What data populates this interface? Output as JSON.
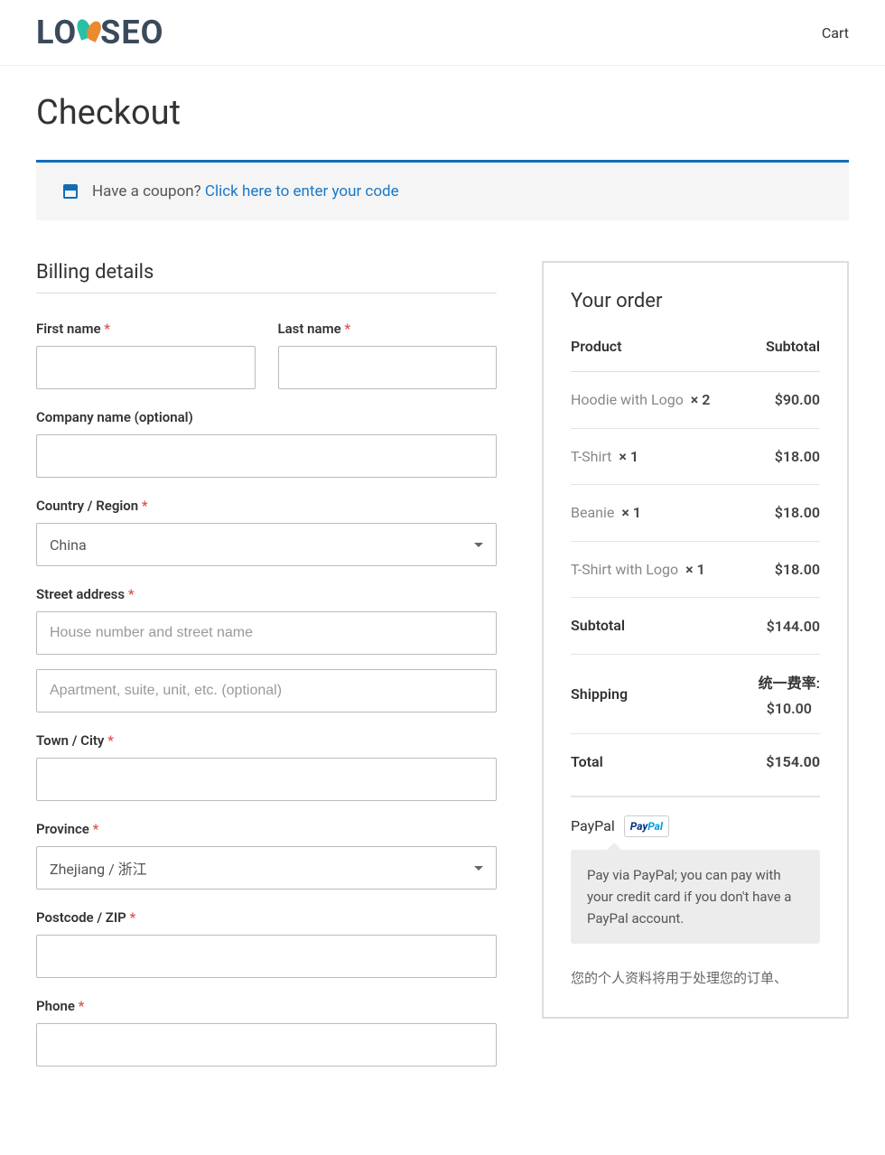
{
  "header": {
    "logo_text_left": "LO",
    "logo_text_right": "SEO",
    "cart_link": "Cart"
  },
  "page": {
    "title": "Checkout"
  },
  "coupon": {
    "prompt": "Have a coupon? ",
    "link": "Click here to enter your code"
  },
  "billing": {
    "heading": "Billing details",
    "first_name_label": "First name",
    "last_name_label": "Last name",
    "company_label": "Company name (optional)",
    "country_label": "Country / Region",
    "country_value": "China",
    "street_label": "Street address",
    "street_ph1": "House number and street name",
    "street_ph2": "Apartment, suite, unit, etc. (optional)",
    "city_label": "Town / City",
    "province_label": "Province",
    "province_value": "Zhejiang / 浙江",
    "zip_label": "Postcode / ZIP",
    "phone_label": "Phone"
  },
  "order": {
    "heading": "Your order",
    "col_product": "Product",
    "col_subtotal": "Subtotal",
    "items": [
      {
        "name": "Hoodie with Logo",
        "qty": "2",
        "subtotal": "$90.00"
      },
      {
        "name": "T-Shirt",
        "qty": "1",
        "subtotal": "$18.00"
      },
      {
        "name": "Beanie",
        "qty": "1",
        "subtotal": "$18.00"
      },
      {
        "name": "T-Shirt with Logo",
        "qty": "1",
        "subtotal": "$18.00"
      }
    ],
    "subtotal_label": "Subtotal",
    "subtotal_value": "$144.00",
    "shipping_label": "Shipping",
    "shipping_method": "统一费率:",
    "shipping_amount": "$10.00",
    "total_label": "Total",
    "total_value": "$154.00"
  },
  "payment": {
    "method": "PayPal",
    "msg": "Pay via PayPal; you can pay with your credit card if you don't have a PayPal account."
  },
  "privacy": "您的个人资料将用于处理您的订单、"
}
